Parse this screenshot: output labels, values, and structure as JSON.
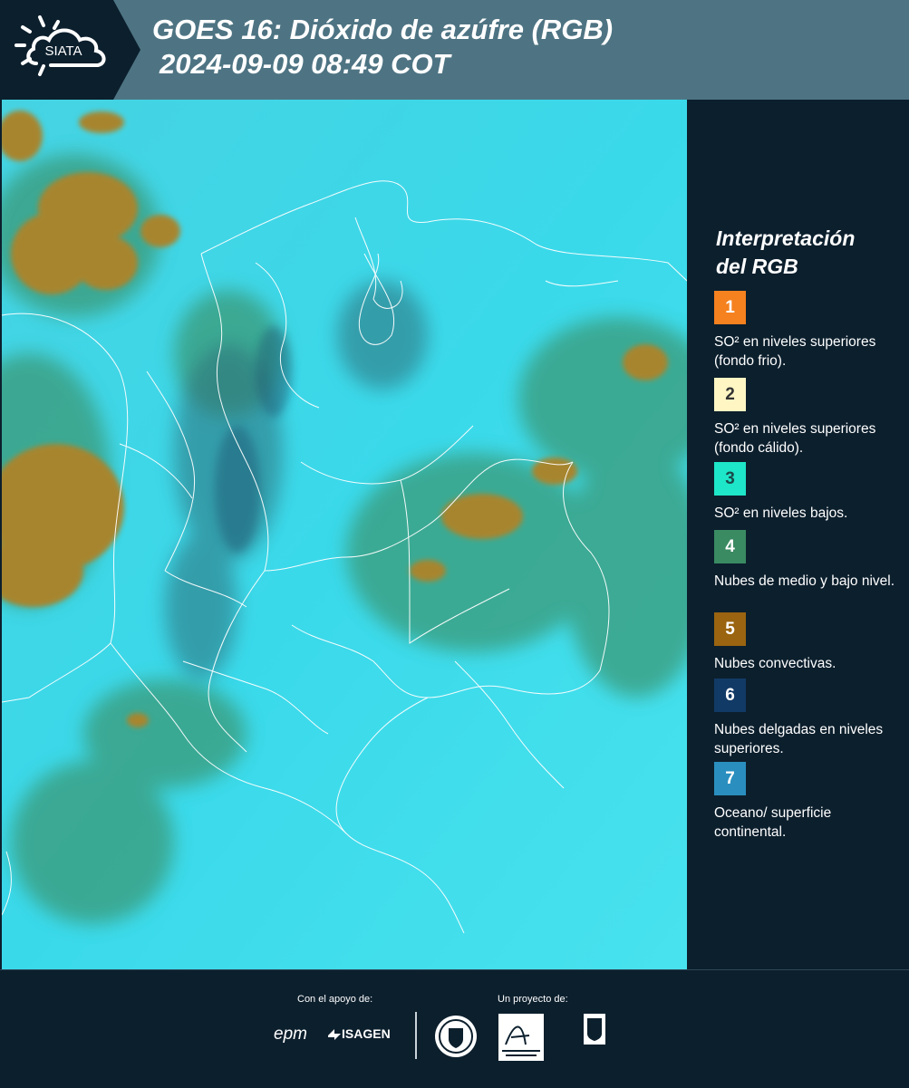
{
  "header": {
    "logo_text": "SIATA",
    "title_line1": "GOES 16: Dióxido de azúfre (RGB)",
    "title_line2": "2024-09-09 08:49 COT"
  },
  "legend": {
    "title_line1": "Interpretación",
    "title_line2": "del RGB",
    "items": [
      {
        "number": "1",
        "color": "#f5811f",
        "text_color": "#ffffff",
        "label": "SO² en niveles superiores (fondo frio)."
      },
      {
        "number": "2",
        "color": "#fff6c4",
        "text_color": "#333333",
        "label": "SO² en niveles superiores (fondo cálido)."
      },
      {
        "number": "3",
        "color": "#1ee6c8",
        "text_color": "#1a4a4a",
        "label": "SO² en niveles bajos."
      },
      {
        "number": "4",
        "color": "#3a8a62",
        "text_color": "#ffffff",
        "label": "Nubes de medio y bajo nivel."
      },
      {
        "number": "5",
        "color": "#9a6410",
        "text_color": "#ffffff",
        "label": "Nubes convectivas."
      },
      {
        "number": "6",
        "color": "#123a66",
        "text_color": "#ffffff",
        "label": "Nubes delgadas en niveles superiores."
      },
      {
        "number": "7",
        "color": "#2a8fbf",
        "text_color": "#ffffff",
        "label": "Oceano/ superficie continental."
      }
    ]
  },
  "footer": {
    "support_label": "Con el apoyo de:",
    "project_label": "Un proyecto de:",
    "sponsors": [
      "epm",
      "ISAGEN"
    ],
    "partners": [
      "Área Metropolitana Valle de Aburrá",
      "Alcaldía de Medellín"
    ]
  }
}
